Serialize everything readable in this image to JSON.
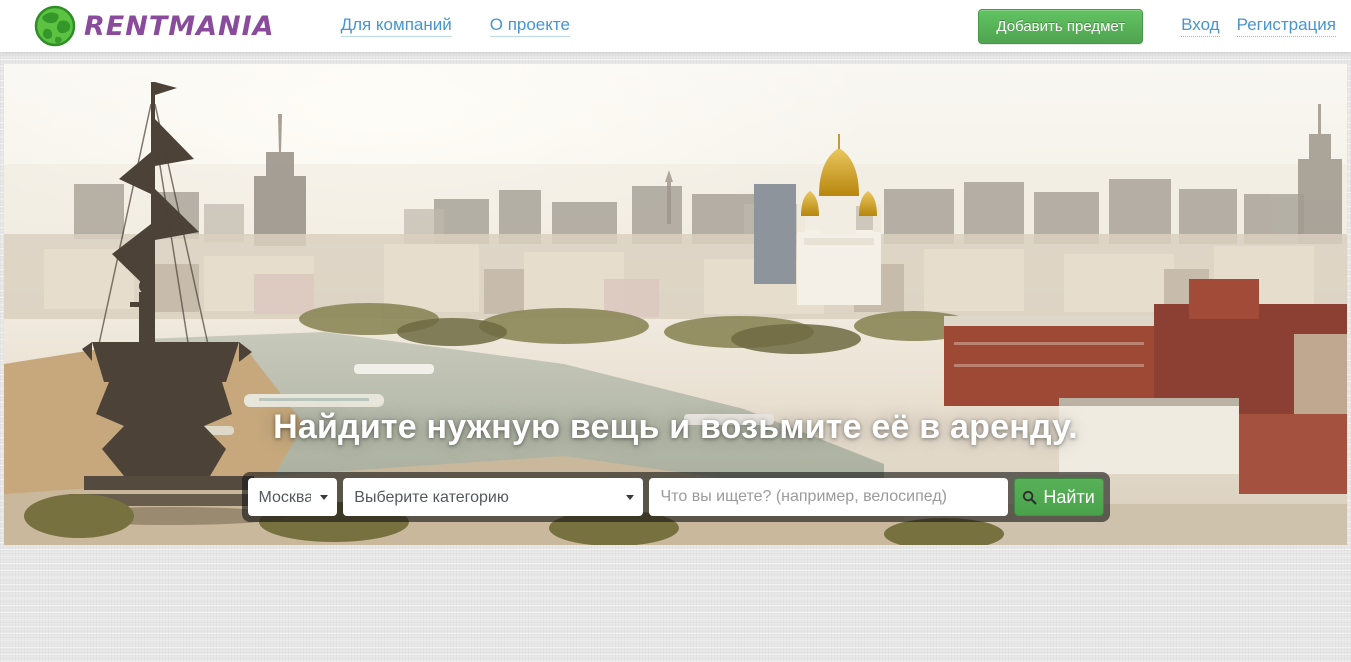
{
  "brand": {
    "name": "RENTMANIA",
    "logo_icon": "globe-icon",
    "logo_color": "#8a4b9d",
    "accent_green": "#5cb85c",
    "link_blue": "#4596d2"
  },
  "header": {
    "nav": [
      {
        "label": "Для компаний"
      },
      {
        "label": "О проекте"
      }
    ],
    "add_item_button": "Добавить предмет",
    "auth_links": [
      {
        "label": "Вход"
      },
      {
        "label": "Регистрация"
      }
    ]
  },
  "hero": {
    "headline": "Найдите нужную вещь и возьмите её в аренду.",
    "search": {
      "city_value": "Москва",
      "category_value": "Выберите категорию",
      "query_placeholder": "Что вы ищете? (например, велосипед)",
      "submit_label": "Найти",
      "submit_icon": "search-icon"
    }
  }
}
